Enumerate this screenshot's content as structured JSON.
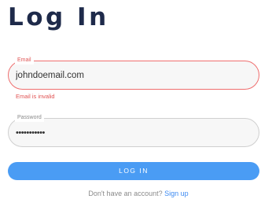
{
  "page": {
    "title": "Log In"
  },
  "form": {
    "email": {
      "label": "Email",
      "value": "johndoemail.com",
      "error": "Email is invalid"
    },
    "password": {
      "label": "Password",
      "value": "•••••••••••"
    },
    "submit_label": "LOG IN"
  },
  "footer": {
    "prompt": "Don't have an account?",
    "link_label": "Sign up"
  },
  "colors": {
    "title": "#1e2a4a",
    "error": "#e05252",
    "primary": "#4a9cf4",
    "link": "#3d8bf2"
  }
}
